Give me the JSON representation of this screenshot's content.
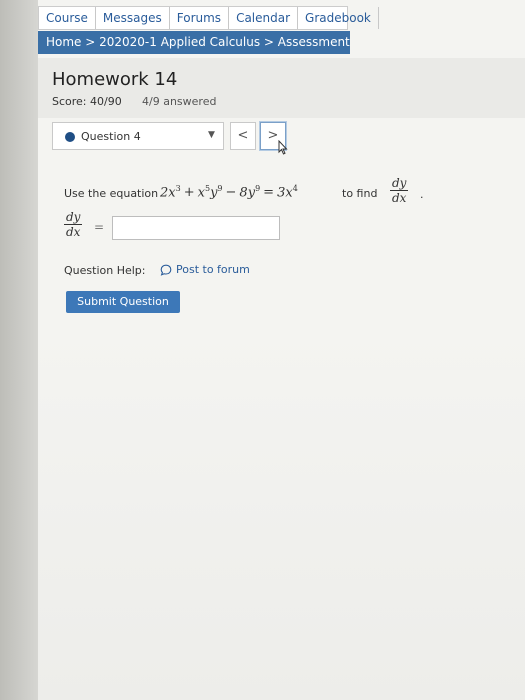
{
  "nav": {
    "tabs": [
      "Course",
      "Messages",
      "Forums",
      "Calendar",
      "Gradebook"
    ]
  },
  "breadcrumb": {
    "text": "Home > 202020-1 Applied Calculus > Assessment"
  },
  "assignment": {
    "title": "Homework 14",
    "score": "Score: 40/90",
    "answered": "4/9 answered"
  },
  "question_select": {
    "selected": "Question 4",
    "prev_label": "<",
    "next_label": ">"
  },
  "question": {
    "lead": "Use the equation",
    "tail": "to find",
    "deriv_num": "dy",
    "deriv_den": "dx",
    "period": ".",
    "equals": "=",
    "answer_value": ""
  },
  "help": {
    "label": "Question Help:",
    "forum_link": "Post to forum"
  },
  "submit_label": "Submit Question",
  "colors": {
    "accent": "#3a6fa6",
    "button": "#3d78b8",
    "link": "#2a5c9a"
  }
}
